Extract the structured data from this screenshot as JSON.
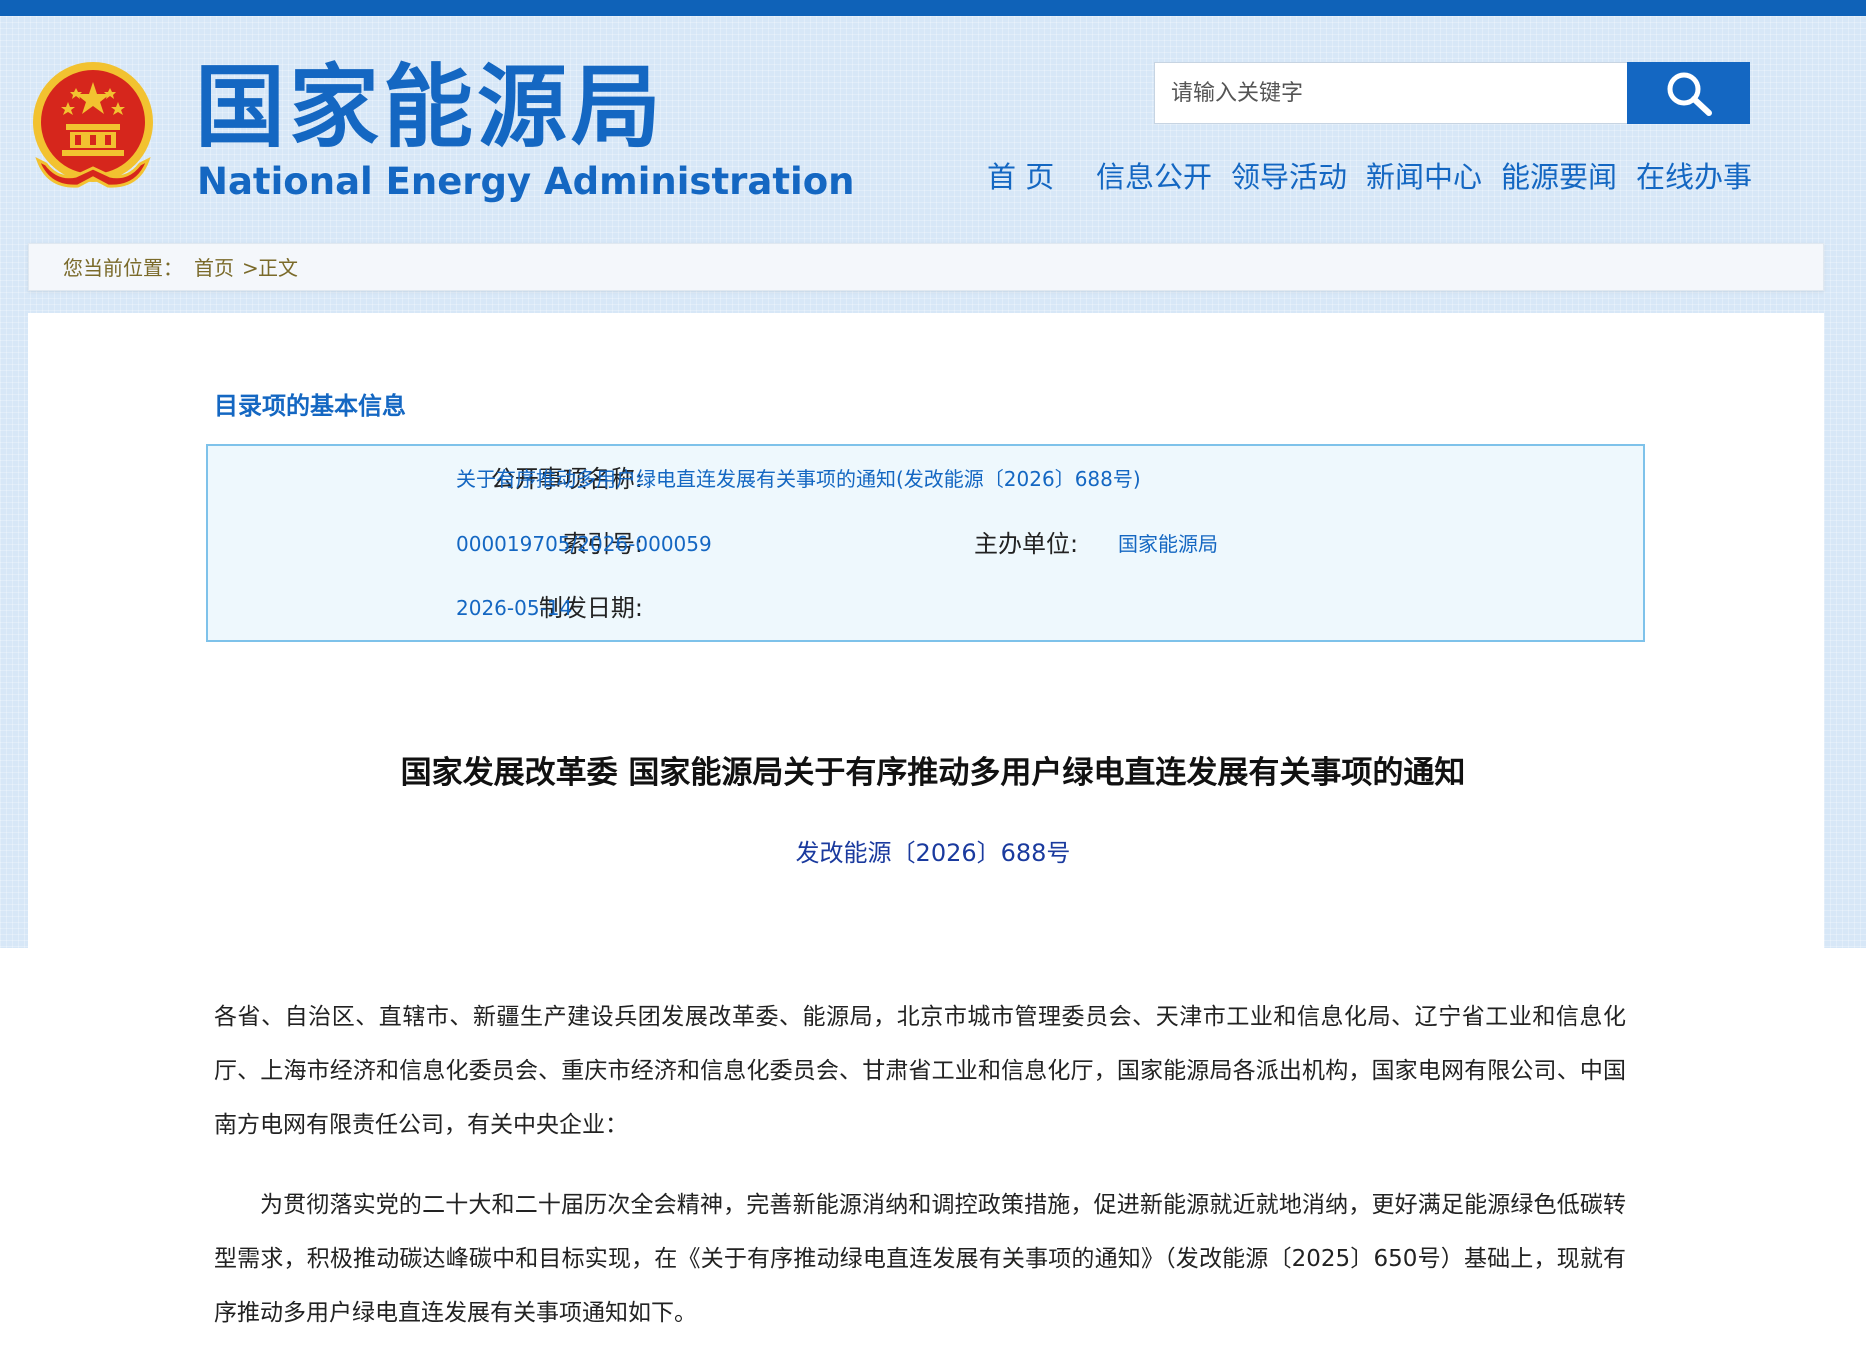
{
  "header": {
    "title_cn": "国家能源局",
    "title_en": "National Energy Administration",
    "search_placeholder": "请输入关键字",
    "emblem_icon": "national-emblem-icon",
    "search_icon": "search-icon"
  },
  "nav": {
    "items": [
      "首 页",
      "信息公开",
      "领导活动",
      "新闻中心",
      "能源要闻",
      "在线办事"
    ]
  },
  "breadcrumb": {
    "prefix": "您当前位置：",
    "home": "首页",
    "separator": ">",
    "current": "正文"
  },
  "info": {
    "section_title": "目录项的基本信息",
    "name_label": "公开事项名称:",
    "name_value": "关于有序推动多用户绿电直连发展有关事项的通知(发改能源〔2026〕688号)",
    "index_label": "索引号:",
    "index_value": "000019705/2026-000059",
    "org_label": "主办单位:",
    "org_value": "国家能源局",
    "date_label": "制发日期:",
    "date_value": "2026-05-14"
  },
  "article": {
    "title": "国家发展改革委 国家能源局关于有序推动多用户绿电直连发展有关事项的通知",
    "doc_number": "发改能源〔2026〕688号",
    "paragraph1": "各省、自治区、直辖市、新疆生产建设兵团发展改革委、能源局，北京市城市管理委员会、天津市工业和信息化局、辽宁省工业和信息化厅、上海市经济和信息化委员会、重庆市经济和信息化委员会、甘肃省工业和信息化厅，国家能源局各派出机构，国家电网有限公司、中国南方电网有限责任公司，有关中央企业：",
    "paragraph2": "为贯彻落实党的二十大和二十届历次全会精神，完善新能源消纳和调控政策措施，促进新能源就近就地消纳，更好满足能源绿色低碳转型需求，积极推动碳达峰碳中和目标实现，在《关于有序推动绿电直连发展有关事项的通知》（发改能源〔2025〕650号）基础上，现就有序推动多用户绿电直连发展有关事项通知如下。"
  },
  "colors": {
    "brand_blue": "#1467c2",
    "top_bar": "#0f62b8",
    "header_bg": "#d7e7f7",
    "info_box_bg": "#eef8fd",
    "info_box_border": "#7ec2ea",
    "breadcrumb_text": "#7a6a2a",
    "emblem_red": "#d6261c",
    "emblem_gold": "#f2c230"
  }
}
